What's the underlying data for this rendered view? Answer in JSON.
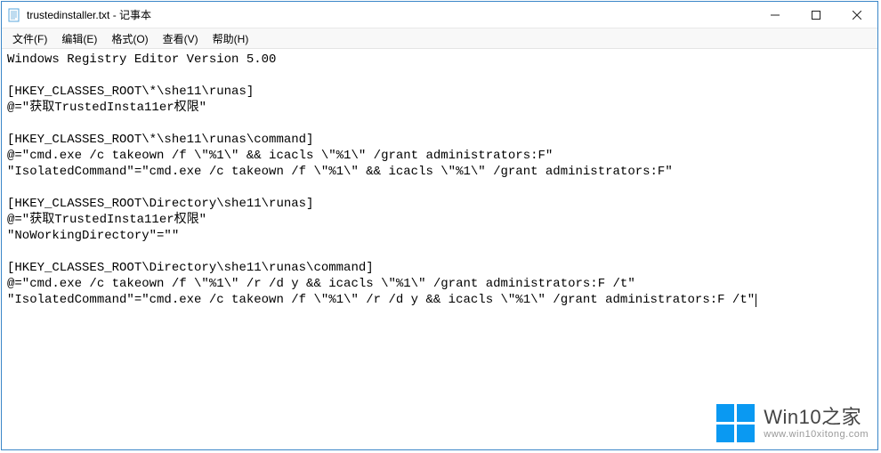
{
  "window": {
    "title": "trustedinstaller.txt - 记事本"
  },
  "menu": {
    "file": "文件(F)",
    "edit": "编辑(E)",
    "format": "格式(O)",
    "view": "查看(V)",
    "help": "帮助(H)"
  },
  "content": {
    "l01": "Windows Registry Editor Version 5.00",
    "l02": "",
    "l03": "[HKEY_CLASSES_ROOT\\*\\she11\\runas]",
    "l04": "@=\"获取TrustedInsta11er权限\"",
    "l05": "",
    "l06": "[HKEY_CLASSES_ROOT\\*\\she11\\runas\\command]",
    "l07": "@=\"cmd.exe /c takeown /f \\\"%1\\\" && icacls \\\"%1\\\" /grant administrators:F\"",
    "l08": "\"IsolatedCommand\"=\"cmd.exe /c takeown /f \\\"%1\\\" && icacls \\\"%1\\\" /grant administrators:F\"",
    "l09": "",
    "l10": "[HKEY_CLASSES_ROOT\\Directory\\she11\\runas]",
    "l11": "@=\"获取TrustedInsta11er权限\"",
    "l12": "\"NoWorkingDirectory\"=\"\"",
    "l13": "",
    "l14": "[HKEY_CLASSES_ROOT\\Directory\\she11\\runas\\command]",
    "l15": "@=\"cmd.exe /c takeown /f \\\"%1\\\" /r /d y && icacls \\\"%1\\\" /grant administrators:F /t\"",
    "l16": "\"IsolatedCommand\"=\"cmd.exe /c takeown /f \\\"%1\\\" /r /d y && icacls \\\"%1\\\" /grant administrators:F /t\""
  },
  "watermark": {
    "title": "Win10之家",
    "url": "www.win10xitong.com"
  }
}
